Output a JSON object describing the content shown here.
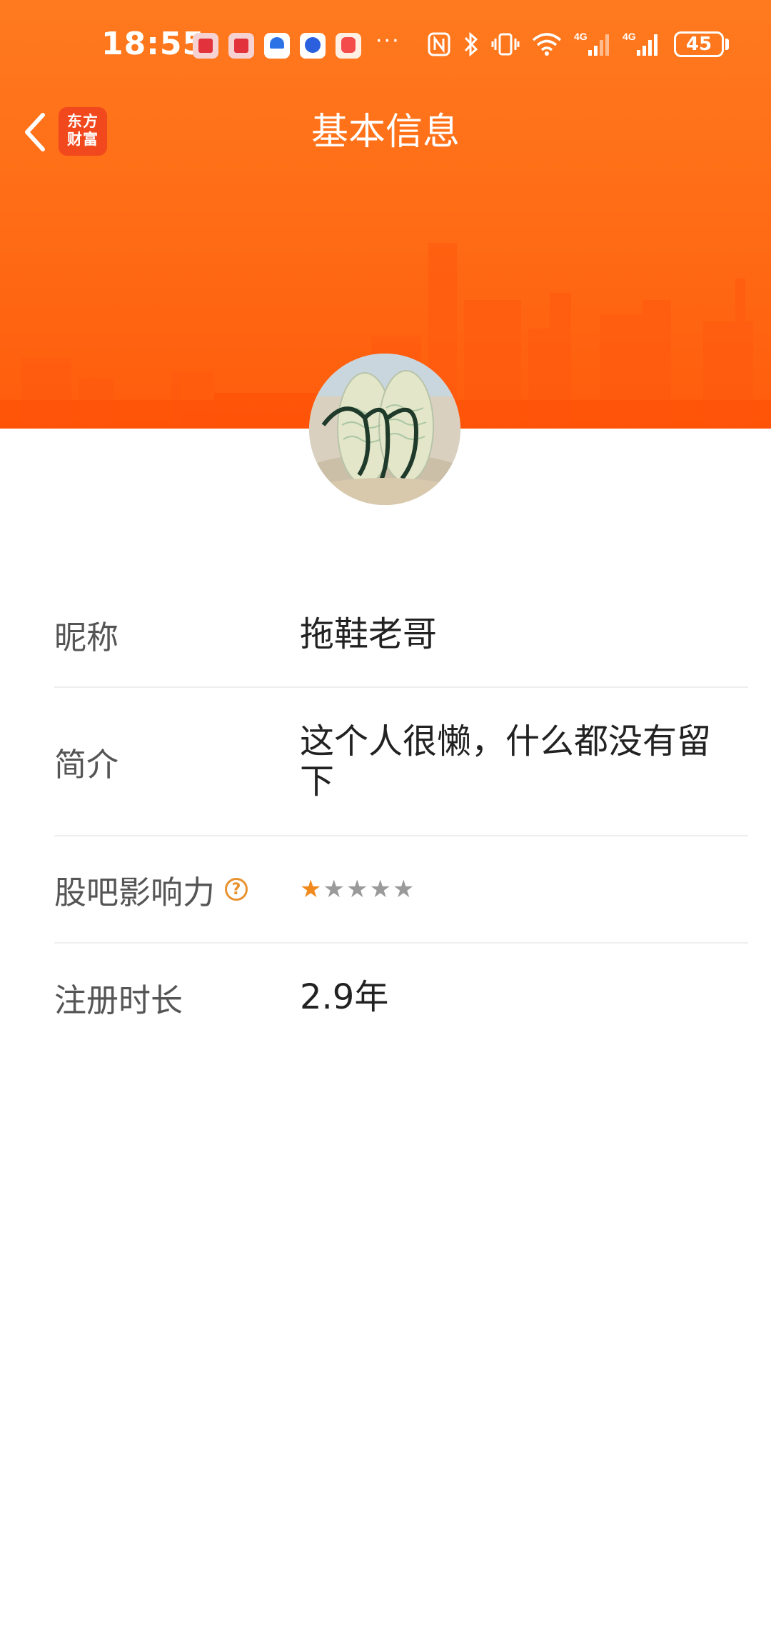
{
  "status_bar": {
    "time": "18:55",
    "more": "···",
    "battery": "45",
    "network_1": "4G",
    "network_2": "4G"
  },
  "header": {
    "title": "基本信息",
    "brand_logo_line1": "东方",
    "brand_logo_line2": "财富"
  },
  "profile": {
    "rows": [
      {
        "label": "昵称",
        "value": "拖鞋老哥"
      },
      {
        "label": "简介",
        "value": "这个人很懒，什么都没有留下"
      },
      {
        "label": "股吧影响力",
        "rating": 1,
        "rating_max": 5
      },
      {
        "label": "注册时长",
        "value": "2.9年"
      }
    ],
    "help_icon_glyph": "?"
  },
  "colors": {
    "banner_orange": "#ff6e16",
    "brand_red": "#f2481d",
    "star_active": "#f08a1d",
    "star_inactive": "#9a9a9a"
  },
  "icons": {
    "back": "chevron-left-icon",
    "help": "question-circle-icon",
    "nfc": "nfc-icon",
    "bluetooth": "bluetooth-icon",
    "vibrate": "vibrate-icon",
    "wifi": "wifi-icon",
    "signal": "cell-signal-icon"
  }
}
